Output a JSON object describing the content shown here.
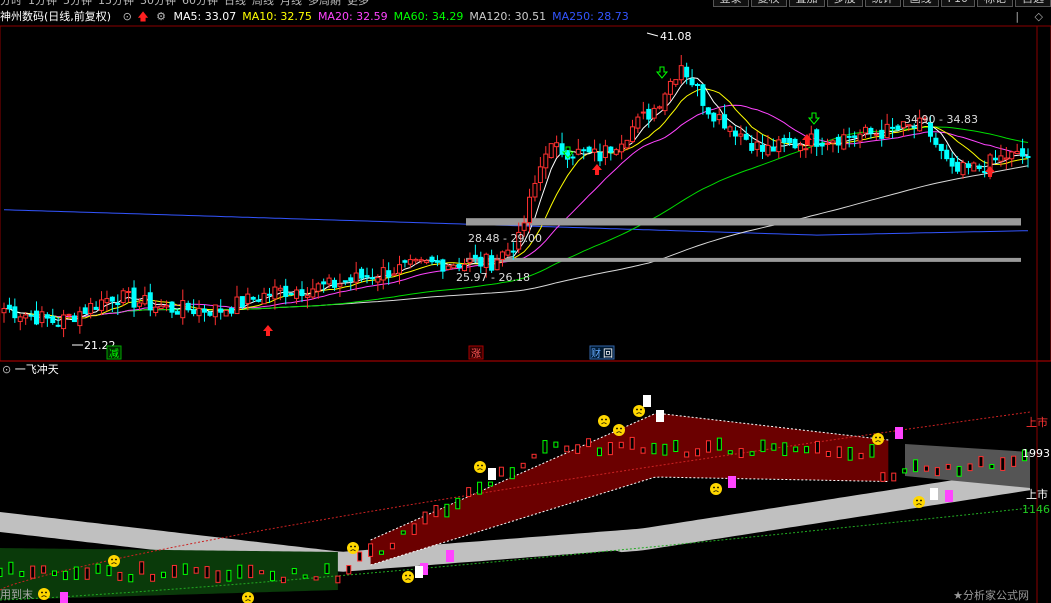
{
  "topbar": {
    "tabs": [
      "分时",
      "1分钟",
      "5分钟",
      "15分钟",
      "30分钟",
      "60分钟",
      "日线",
      "周线",
      "月线",
      "多周期",
      "更多"
    ],
    "buttons": [
      "登录",
      "复权",
      "叠加",
      "多股",
      "统计",
      "画线",
      "F10",
      "标记",
      "自选"
    ]
  },
  "header": {
    "title": "神州数码(日线,前复权)",
    "ma": [
      {
        "label": "MA5: 33.07",
        "color": "#ffffff"
      },
      {
        "label": "MA10: 32.75",
        "color": "#ffff00"
      },
      {
        "label": "MA20: 32.59",
        "color": "#ff44ff"
      },
      {
        "label": "MA60: 34.29",
        "color": "#00ff00"
      },
      {
        "label": "MA120: 30.51",
        "color": "#cccccc"
      },
      {
        "label": "MA250: 28.73",
        "color": "#3355ff"
      }
    ]
  },
  "indicator": {
    "name": "一飞冲天"
  },
  "watermark": "★分析家公式网",
  "chart_data": [
    {
      "type": "candlestick",
      "title": "神州数码(日线,前复权)",
      "price_range_visible": [
        19.5,
        42.5
      ],
      "annotations": [
        {
          "text": "41.08",
          "kind": "high"
        },
        {
          "text": "21.22",
          "kind": "low"
        },
        {
          "text": "34.90 - 34.83",
          "kind": "level"
        },
        {
          "text": "28.48 - 29.00",
          "kind": "zone"
        },
        {
          "text": "25.97 - 26.18",
          "kind": "zone"
        }
      ],
      "event_markers": [
        "减",
        "涨",
        "财|回"
      ],
      "series_note": "MA5, MA10, MA20, MA60, MA120, MA250 moving averages",
      "candles_approx": [
        {
          "i": 0,
          "o": 21.8,
          "c": 22.6
        },
        {
          "i": 10,
          "o": 22.4,
          "c": 21.6
        },
        {
          "i": 20,
          "o": 22.0,
          "c": 23.5
        },
        {
          "i": 30,
          "o": 22.9,
          "c": 22.6
        },
        {
          "i": 40,
          "o": 23.6,
          "c": 22.5
        },
        {
          "i": 50,
          "o": 23.0,
          "c": 23.8
        },
        {
          "i": 60,
          "o": 23.4,
          "c": 24.2
        },
        {
          "i": 70,
          "o": 24.8,
          "c": 25.2
        },
        {
          "i": 80,
          "o": 25.0,
          "c": 25.8
        },
        {
          "i": 90,
          "o": 25.2,
          "c": 25.9
        },
        {
          "i": 95,
          "o": 26.0,
          "c": 27.4
        },
        {
          "i": 100,
          "o": 29.0,
          "c": 34.0
        },
        {
          "i": 110,
          "o": 31.8,
          "c": 33.4
        },
        {
          "i": 120,
          "o": 34.8,
          "c": 36.8
        },
        {
          "i": 125,
          "o": 38.0,
          "c": 40.0
        },
        {
          "i": 130,
          "o": 38.5,
          "c": 36.8
        },
        {
          "i": 140,
          "o": 35.8,
          "c": 33.8
        },
        {
          "i": 150,
          "o": 33.4,
          "c": 34.6
        },
        {
          "i": 160,
          "o": 34.2,
          "c": 35.0
        },
        {
          "i": 170,
          "o": 34.8,
          "c": 35.6
        },
        {
          "i": 175,
          "o": 34.2,
          "c": 32.2
        },
        {
          "i": 180,
          "o": 31.9,
          "c": 32.6
        },
        {
          "i": 185,
          "o": 32.6,
          "c": 33.4
        }
      ]
    },
    {
      "type": "band-oscillator",
      "title": "一飞冲天",
      "labels": [
        "上市",
        "1993",
        "上市",
        "1146"
      ]
    }
  ],
  "status_text": "用到末",
  "colors": {
    "up": "#ff3030",
    "down": "#00ffff",
    "bg": "#000000",
    "grid": "#8b0000",
    "band_fill": "#6b0000",
    "band_green": "#0a3a0a",
    "gray_band": "#c8c8c8"
  }
}
